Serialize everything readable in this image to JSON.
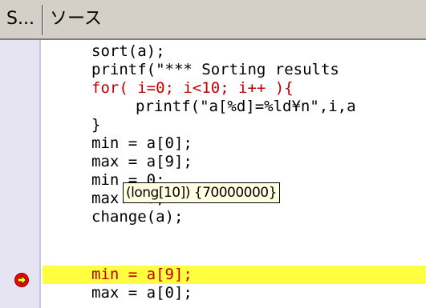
{
  "header": {
    "col1_label": "S...",
    "col2_label": "ソース"
  },
  "source_lines": [
    {
      "indent": 1,
      "text": "sort(a);",
      "style": "normal"
    },
    {
      "indent": 1,
      "text": "printf(\"*** Sorting results",
      "style": "normal"
    },
    {
      "indent": 1,
      "text": "for( i=0; i<10; i++ ){",
      "style": "keyword"
    },
    {
      "indent": 2,
      "text": "printf(\"a[%d]=%ld¥n\",i,a",
      "style": "normal"
    },
    {
      "indent": 1,
      "text": "}",
      "style": "normal"
    },
    {
      "indent": 1,
      "text": "min = a[0];",
      "style": "normal"
    },
    {
      "indent": 1,
      "text": "max = a[9];",
      "style": "normal"
    },
    {
      "indent": 1,
      "text": "min = 0;",
      "style": "normal"
    },
    {
      "indent": 1,
      "text": "max = 0;",
      "style": "normal"
    },
    {
      "indent": 1,
      "text": "change(a);",
      "style": "normal"
    },
    {
      "indent": 1,
      "text": "min = a[9];",
      "style": "current"
    },
    {
      "indent": 1,
      "text": "max = a[0];",
      "style": "normal"
    }
  ],
  "tooltip": {
    "text": "(long[10])  {70000000}"
  },
  "marker": {
    "icon": "current-line-arrow-icon",
    "color": "#ff0000",
    "arrow_color": "#ffff00"
  },
  "colors": {
    "current_line_bg": "#ffff40",
    "keyword": "#c00000",
    "gutter_bg": "#e6e4f2"
  }
}
